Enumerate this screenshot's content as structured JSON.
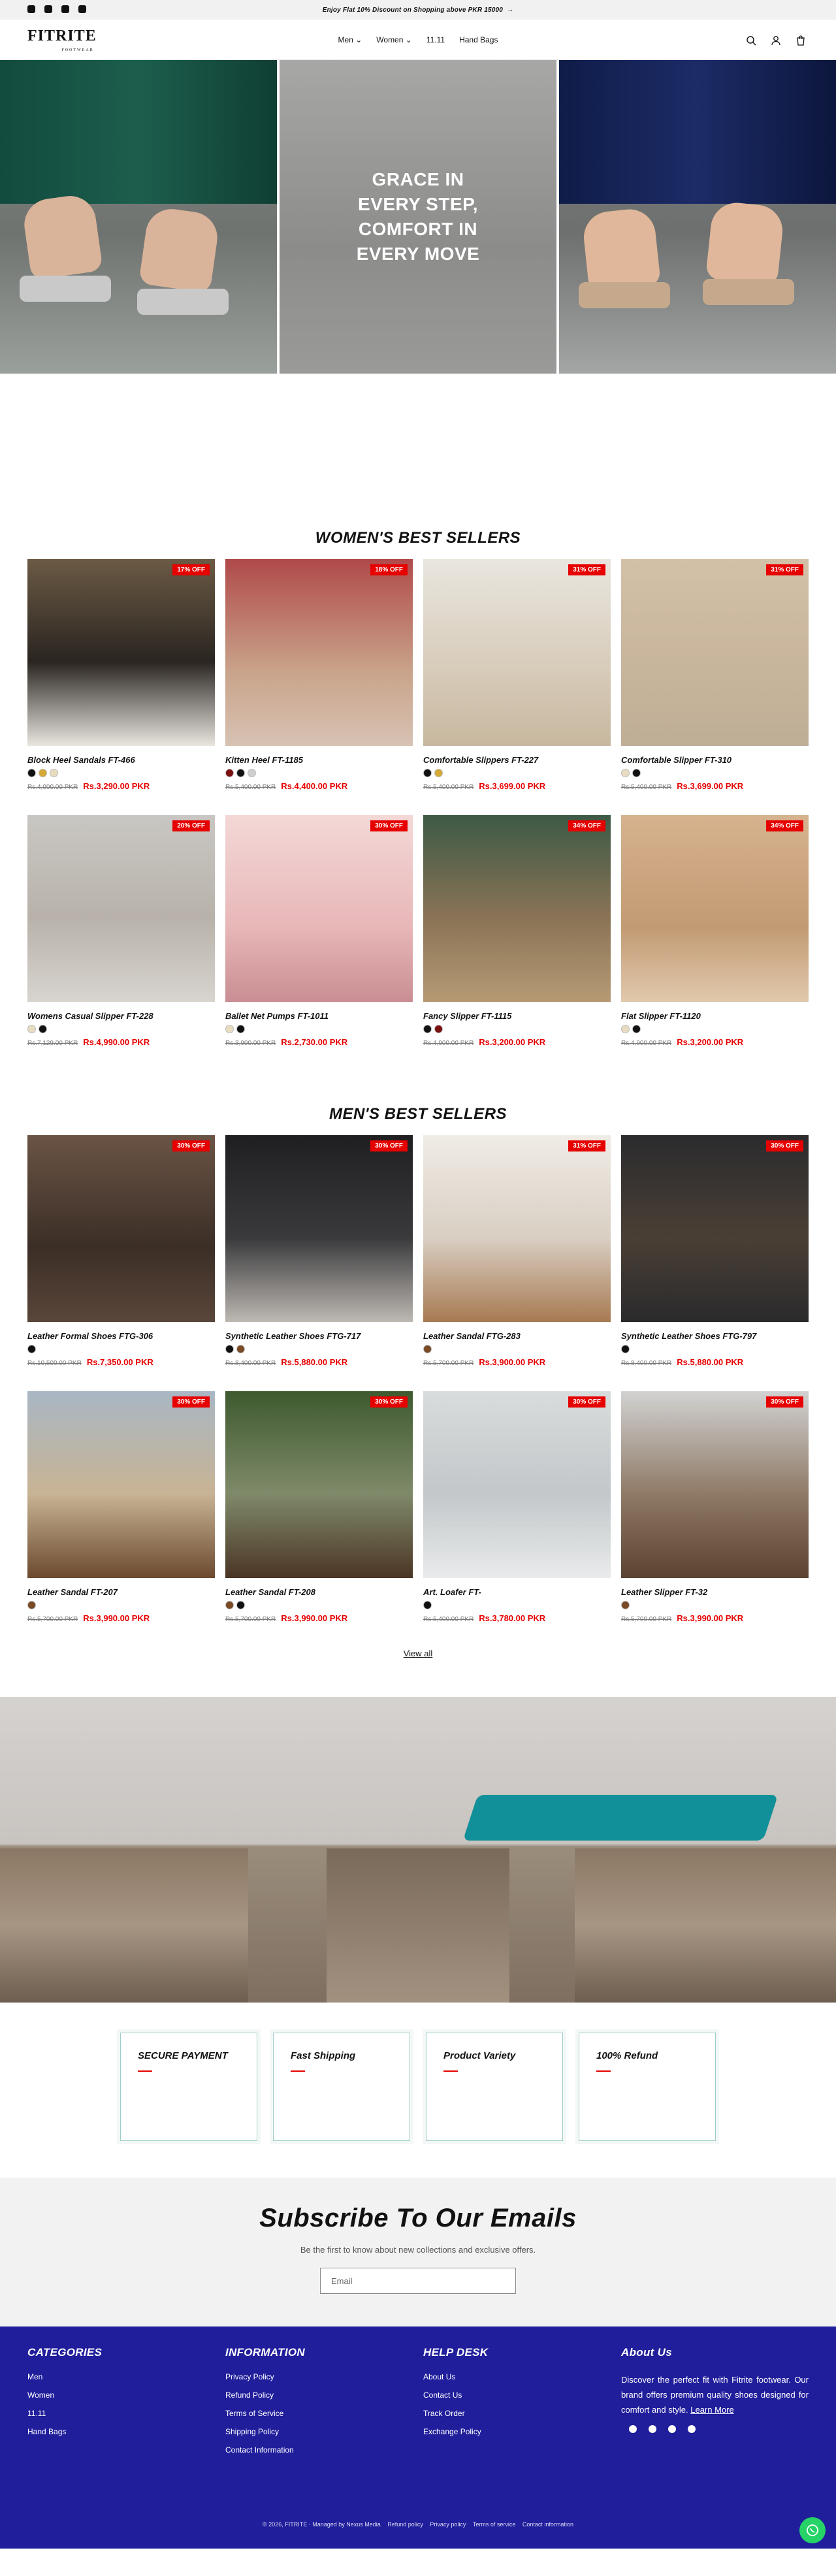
{
  "announcement": {
    "text": "Enjoy Flat 10% Discount on Shopping above PKR 15000",
    "arrow": "→"
  },
  "brand": {
    "name": "FITRITE",
    "tagline": "FOOTWEAR"
  },
  "nav": {
    "items": [
      "Men",
      "Women",
      "11.11",
      "Hand Bags"
    ],
    "chevron": "⌄"
  },
  "header_icons": [
    "search-icon",
    "account-icon",
    "cart-icon"
  ],
  "hero": {
    "headline_lines": [
      "GRACE IN",
      "EVERY STEP,",
      "COMFORT IN",
      "EVERY MOVE"
    ]
  },
  "womens": {
    "title": "WOMEN'S BEST SELLERS",
    "products": [
      {
        "title": "Block Heel Sandals FT-466",
        "badge": "17% OFF",
        "old": "Rs.4,000.00 PKR",
        "price": "Rs.3,290.00 PKR",
        "swatches": [
          "#111111",
          "#d4a935",
          "#e8dcc0"
        ]
      },
      {
        "title": "Kitten Heel FT-1185",
        "badge": "18% OFF",
        "old": "Rs.5,400.00 PKR",
        "price": "Rs.4,400.00 PKR",
        "swatches": [
          "#7a1010",
          "#111111",
          "#cfcfcf"
        ]
      },
      {
        "title": "Comfortable Slippers FT-227",
        "badge": "31% OFF",
        "old": "Rs.5,400.00 PKR",
        "price": "Rs.3,699.00 PKR",
        "swatches": [
          "#111111",
          "#d4a935"
        ]
      },
      {
        "title": "Comfortable Slipper FT-310",
        "badge": "31% OFF",
        "old": "Rs.5,400.00 PKR",
        "price": "Rs.3,699.00 PKR",
        "swatches": [
          "#e8dcc0",
          "#111111"
        ]
      },
      {
        "title": "Womens Casual Slipper FT-228",
        "badge": "20% OFF",
        "old": "Rs.7,129.00 PKR",
        "price": "Rs.4,990.00 PKR",
        "swatches": [
          "#e8dcc0",
          "#111111"
        ]
      },
      {
        "title": "Ballet Net Pumps FT-1011",
        "badge": "30% OFF",
        "old": "Rs.3,900.00 PKR",
        "price": "Rs.2,730.00 PKR",
        "swatches": [
          "#e8dcc0",
          "#111111"
        ]
      },
      {
        "title": "Fancy Slipper FT-1115",
        "badge": "34% OFF",
        "old": "Rs.4,900.00 PKR",
        "price": "Rs.3,200.00 PKR",
        "swatches": [
          "#111111",
          "#7a1010"
        ]
      },
      {
        "title": "Flat Slipper FT-1120",
        "badge": "34% OFF",
        "old": "Rs.4,900.00 PKR",
        "price": "Rs.3,200.00 PKR",
        "swatches": [
          "#e8dcc0",
          "#111111"
        ]
      }
    ]
  },
  "mens": {
    "title": "MEN'S BEST SELLERS",
    "products": [
      {
        "title": "Leather Formal Shoes FTG-306",
        "badge": "30% OFF",
        "old": "Rs.10,500.00 PKR",
        "price": "Rs.7,350.00 PKR",
        "swatches": [
          "#111111"
        ]
      },
      {
        "title": "Synthetic Leather Shoes FTG-717",
        "badge": "30% OFF",
        "old": "Rs.8,400.00 PKR",
        "price": "Rs.5,880.00 PKR",
        "swatches": [
          "#111111",
          "#7a4a25"
        ]
      },
      {
        "title": "Leather Sandal FTG-283",
        "badge": "31% OFF",
        "old": "Rs.5,700.00 PKR",
        "price": "Rs.3,900.00 PKR",
        "swatches": [
          "#7a4a25"
        ]
      },
      {
        "title": "Synthetic Leather Shoes FTG-797",
        "badge": "30% OFF",
        "old": "Rs.8,400.00 PKR",
        "price": "Rs.5,880.00 PKR",
        "swatches": [
          "#111111"
        ]
      },
      {
        "title": "Leather Sandal FT-207",
        "badge": "30% OFF",
        "old": "Rs.5,700.00 PKR",
        "price": "Rs.3,990.00 PKR",
        "swatches": [
          "#7a4a25"
        ]
      },
      {
        "title": "Leather Sandal FT-208",
        "badge": "30% OFF",
        "old": "Rs.5,700.00 PKR",
        "price": "Rs.3,990.00 PKR",
        "swatches": [
          "#7a4a25",
          "#111111"
        ]
      },
      {
        "title": "Art. Loafer FT-",
        "badge": "30% OFF",
        "old": "Rs.5,400.00 PKR",
        "price": "Rs.3,780.00 PKR",
        "swatches": [
          "#111111"
        ]
      },
      {
        "title": "Leather Slipper FT-32",
        "badge": "30% OFF",
        "old": "Rs.5,700.00 PKR",
        "price": "Rs.3,990.00 PKR",
        "swatches": [
          "#7a4a25"
        ]
      }
    ],
    "view_all": "View all"
  },
  "features": [
    "SECURE PAYMENT",
    "Fast Shipping",
    "Product Variety",
    "100% Refund"
  ],
  "subscribe": {
    "title": "Subscribe To Our Emails",
    "text": "Be the first to know about new collections and exclusive offers.",
    "placeholder": "Email"
  },
  "footer": {
    "categories": {
      "title": "CATEGORIES",
      "links": [
        "Men",
        "Women",
        "11.11",
        "Hand Bags"
      ]
    },
    "information": {
      "title": "INFORMATION",
      "links": [
        "Privacy Policy",
        "Refund Policy",
        "Terms of Service",
        "Shipping Policy",
        "Contact Information"
      ]
    },
    "helpdesk": {
      "title": "HELP DESK",
      "links": [
        "About Us",
        "Contact Us",
        "Track Order",
        "Exchange Policy"
      ]
    },
    "about": {
      "title": "About Us",
      "text": "Discover the perfect fit with Fitrite footwear. Our brand offers premium quality shoes designed for comfort and style.",
      "link": "Learn More"
    },
    "copyright": "© 2026, FITRITE · Managed by Nexus Media",
    "bottom_links": [
      "Refund policy",
      "Privacy policy",
      "Terms of service",
      "Contact information"
    ]
  },
  "colors": {
    "accent": "#e60000",
    "footer_bg": "#201e9b",
    "feature_border": "#9fcdc8",
    "whatsapp": "#25d366"
  }
}
